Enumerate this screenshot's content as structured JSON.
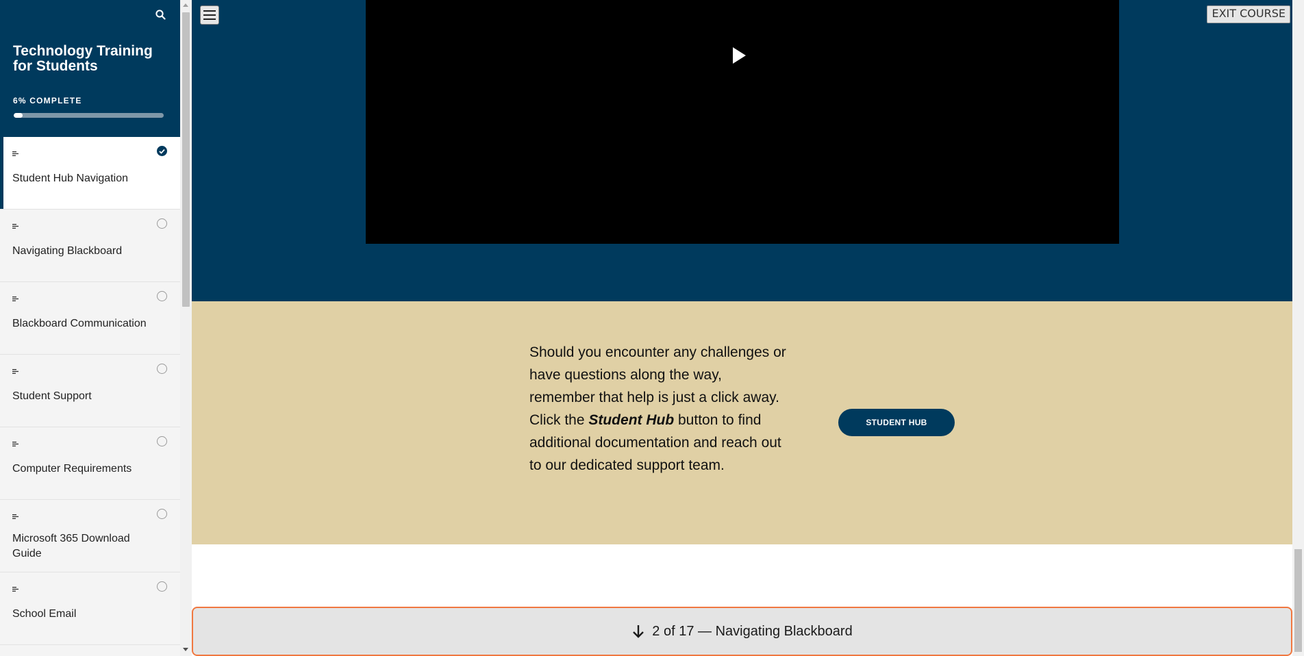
{
  "sidebar": {
    "course_title": "Technology Training for Students",
    "progress_label": "6% COMPLETE",
    "progress_fraction": 0.06,
    "lessons": [
      {
        "title": "Student Hub Navigation",
        "completed": true,
        "active": true
      },
      {
        "title": "Navigating Blackboard",
        "completed": false
      },
      {
        "title": "Blackboard Communication",
        "completed": false
      },
      {
        "title": "Student Support",
        "completed": false
      },
      {
        "title": "Computer Requirements",
        "completed": false
      },
      {
        "title": "Microsoft 365 Download Guide",
        "completed": false
      },
      {
        "title": "School Email",
        "completed": false
      }
    ]
  },
  "header": {
    "exit_label": "EXIT COURSE"
  },
  "info": {
    "text_before": "Should you encounter any challenges or have questions along the way, remember that help is just a click away. Click the ",
    "text_emphasis": "Student Hub",
    "text_after": " button to find additional documentation and reach out to our dedicated support team.",
    "button_label": "STUDENT HUB"
  },
  "next_lesson": {
    "label": "2 of 17 — Navigating Blackboard"
  },
  "colors": {
    "brand_navy": "#003a5d",
    "sand": "#e0d0a5",
    "focus_orange": "#f07840"
  },
  "icons": {
    "search": "search-icon",
    "menu": "hamburger-icon",
    "play": "play-icon",
    "arrow": "arrow-down-icon",
    "check": "check-circle-icon",
    "lesson_type": "text-lines-icon"
  }
}
